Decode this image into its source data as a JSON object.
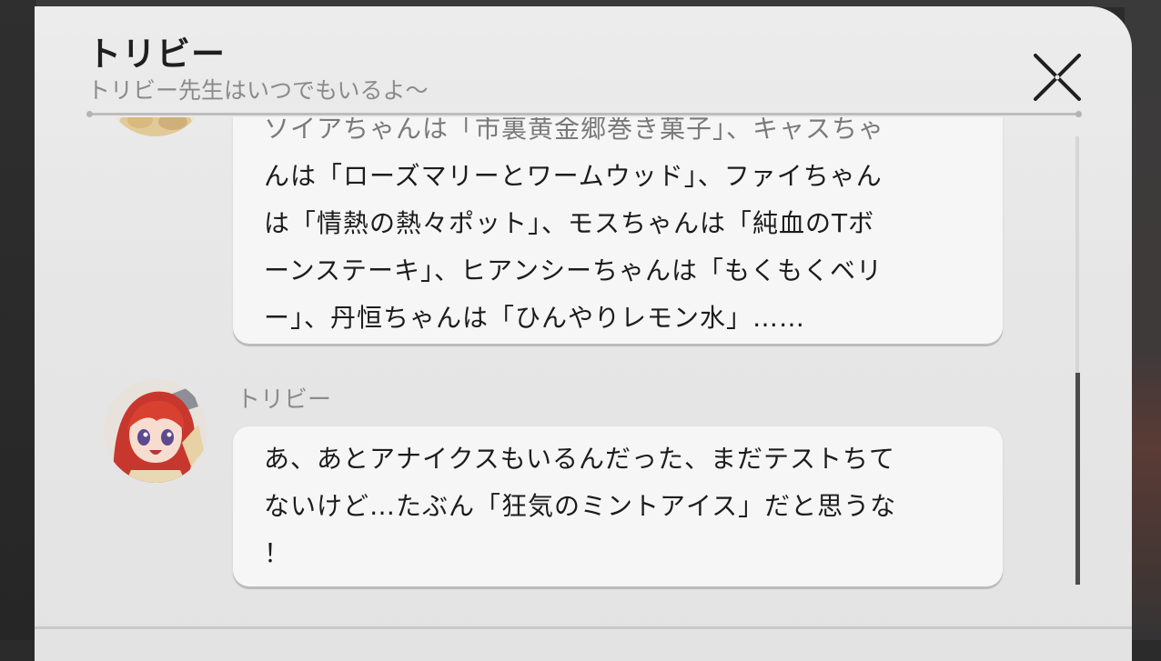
{
  "dialog": {
    "title": "トリビー",
    "subtitle": "トリビー先生はいつでもいるよ～"
  },
  "messages": [
    {
      "sender": "",
      "lines": [
        "ソイアちゃんは「市裏黄金郷巻き菓子」、キャスちゃ",
        "んは「ローズマリーとワームウッド」、ファイちゃん",
        "は「情熱の熱々ポット」、モスちゃんは「純血のTボ",
        "ーンステーキ」、ヒアンシーちゃんは「もくもくベリ",
        "ー」、丹恒ちゃんは「ひんやりレモン水」……"
      ]
    },
    {
      "sender": "トリビー",
      "lines": [
        "あ、あとアナイクスもいるんだった、まだテストちて",
        "ないけど…たぶん「狂気のミントアイス」だと思うな",
        "！"
      ]
    }
  ],
  "icons": {
    "close": "close-icon",
    "avatar": "avatar-trivia-icon"
  },
  "colors": {
    "panel": "#e6e6e6",
    "bubble": "#f6f6f6",
    "title_text": "#1f1f1f",
    "subtitle_text": "#8a8a8a",
    "avatar_hair": "#c8372d"
  }
}
